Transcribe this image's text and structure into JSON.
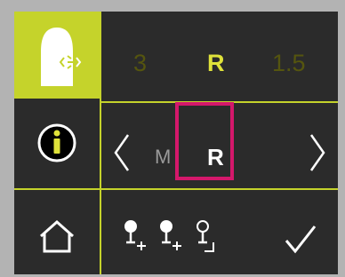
{
  "status_row": {
    "left_value": "3",
    "center_value": "R",
    "right_value": "1.5"
  },
  "selector_row": {
    "prev_option": "M",
    "selected_option": "R"
  },
  "icons": {
    "rail": [
      "tip-device-icon",
      "info-icon",
      "home-icon"
    ],
    "selector": [
      "chevron-left-icon",
      "chevron-right-icon"
    ],
    "actions": [
      "probe-steps-icon",
      "checkmark-icon"
    ]
  },
  "colors": {
    "accent": "#c5d32b",
    "highlight": "#d4186b",
    "background": "#2b2b2b"
  }
}
